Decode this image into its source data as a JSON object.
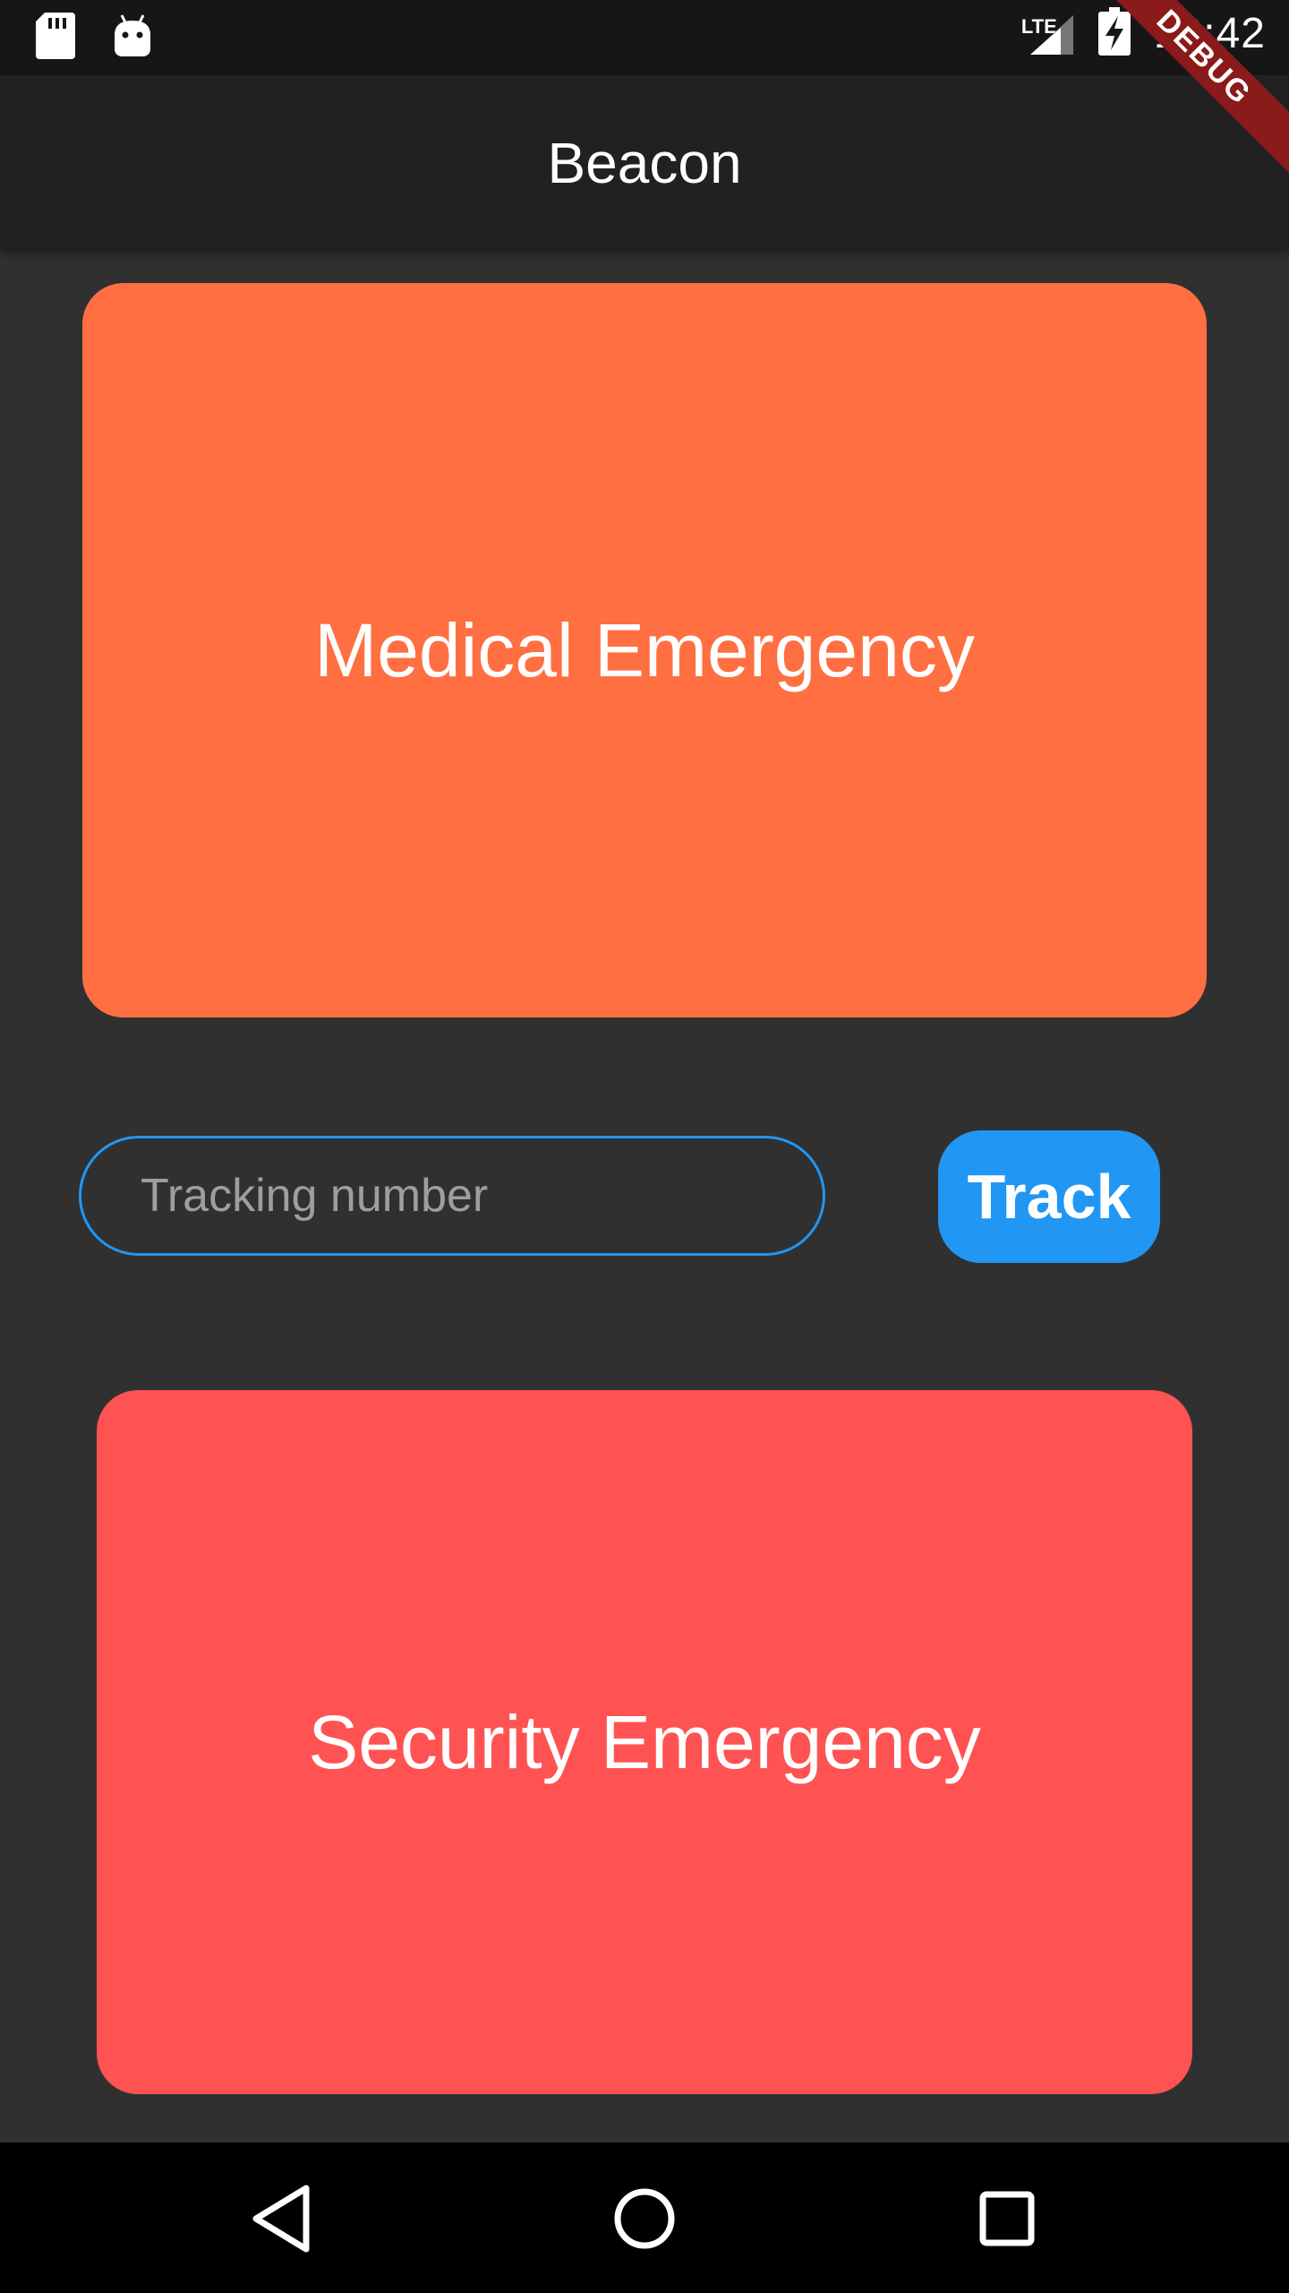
{
  "status_bar": {
    "time": "10:42",
    "network": "LTE",
    "icons": [
      "sd-card-icon",
      "android-icon",
      "signal-icon",
      "battery-charging-icon"
    ]
  },
  "app_bar": {
    "title": "Beacon"
  },
  "debug_banner": "DEBUG",
  "medical_card": {
    "label": "Medical Emergency",
    "color": "#ff6f42"
  },
  "tracking": {
    "placeholder": "Tracking number",
    "value": "",
    "button_label": "Track",
    "accent_color": "#2196f3"
  },
  "security_card": {
    "label": "Security Emergency",
    "color": "#ff5252"
  },
  "nav_bar": {
    "icons": [
      "back-icon",
      "home-icon",
      "recents-icon"
    ]
  }
}
